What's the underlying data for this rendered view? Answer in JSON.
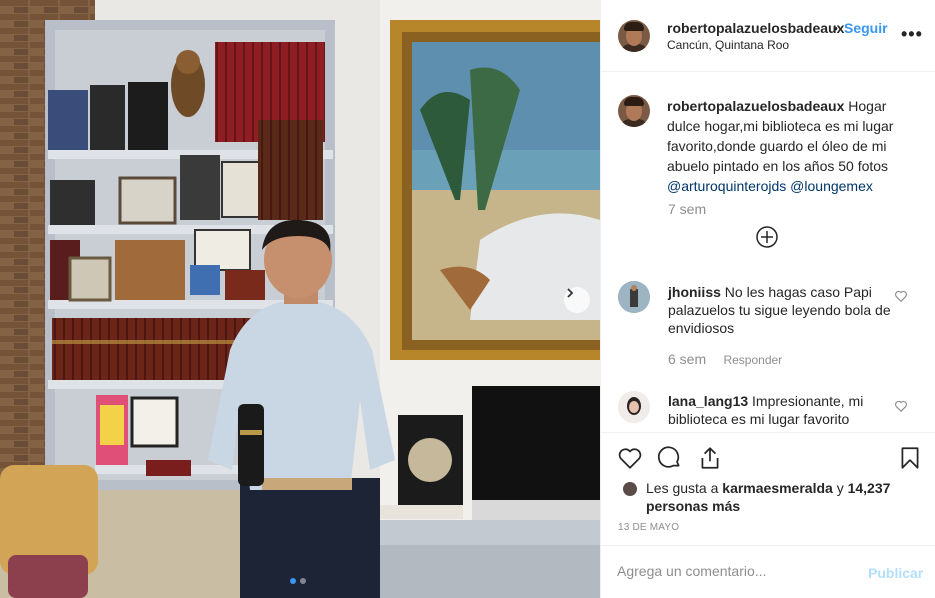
{
  "post": {
    "image_alt": "Man holding a book in a home library with a framed oil painting",
    "carousel_dots": 2,
    "active_dot": 0
  },
  "header": {
    "username": "robertopalazuelosbadeaux",
    "separator": "•",
    "follow_label": "Seguir",
    "location": "Cancún, Quintana Roo",
    "more_icon": "more-horizontal-icon"
  },
  "caption": {
    "username": "robertopalazuelosbadeaux",
    "text": "Hogar dulce hogar,mi biblioteca es mi lugar favorito,donde guardo el óleo de mi abuelo pintado en los años 50 fotos",
    "mention1": "@arturoquinterojds",
    "mention2": "@loungemex",
    "time": "7 sem"
  },
  "comments": [
    {
      "username": "jhoniiss",
      "text": "No les hagas caso Papi palazuelos tu sigue leyendo bola de envidiosos",
      "time": "6 sem",
      "reply_label": "Responder"
    },
    {
      "username": "lana_lang13",
      "text": "Impresionante, mi biblioteca es mi lugar favorito"
    }
  ],
  "actions": {
    "like_icon": "heart-icon",
    "comment_icon": "comment-icon",
    "share_icon": "share-icon",
    "save_icon": "bookmark-icon"
  },
  "likes": {
    "prefix": "Les gusta a",
    "user": "karmaesmeralda",
    "joiner": "y",
    "count": "14,237 personas más"
  },
  "date": "13 DE MAYO",
  "add_comment": {
    "placeholder": "Agrega un comentario...",
    "post_label": "Publicar"
  },
  "colors": {
    "link": "#3897f0",
    "mention": "#003569",
    "muted": "#8e8e8e",
    "post_disabled": "#b2dffc"
  }
}
